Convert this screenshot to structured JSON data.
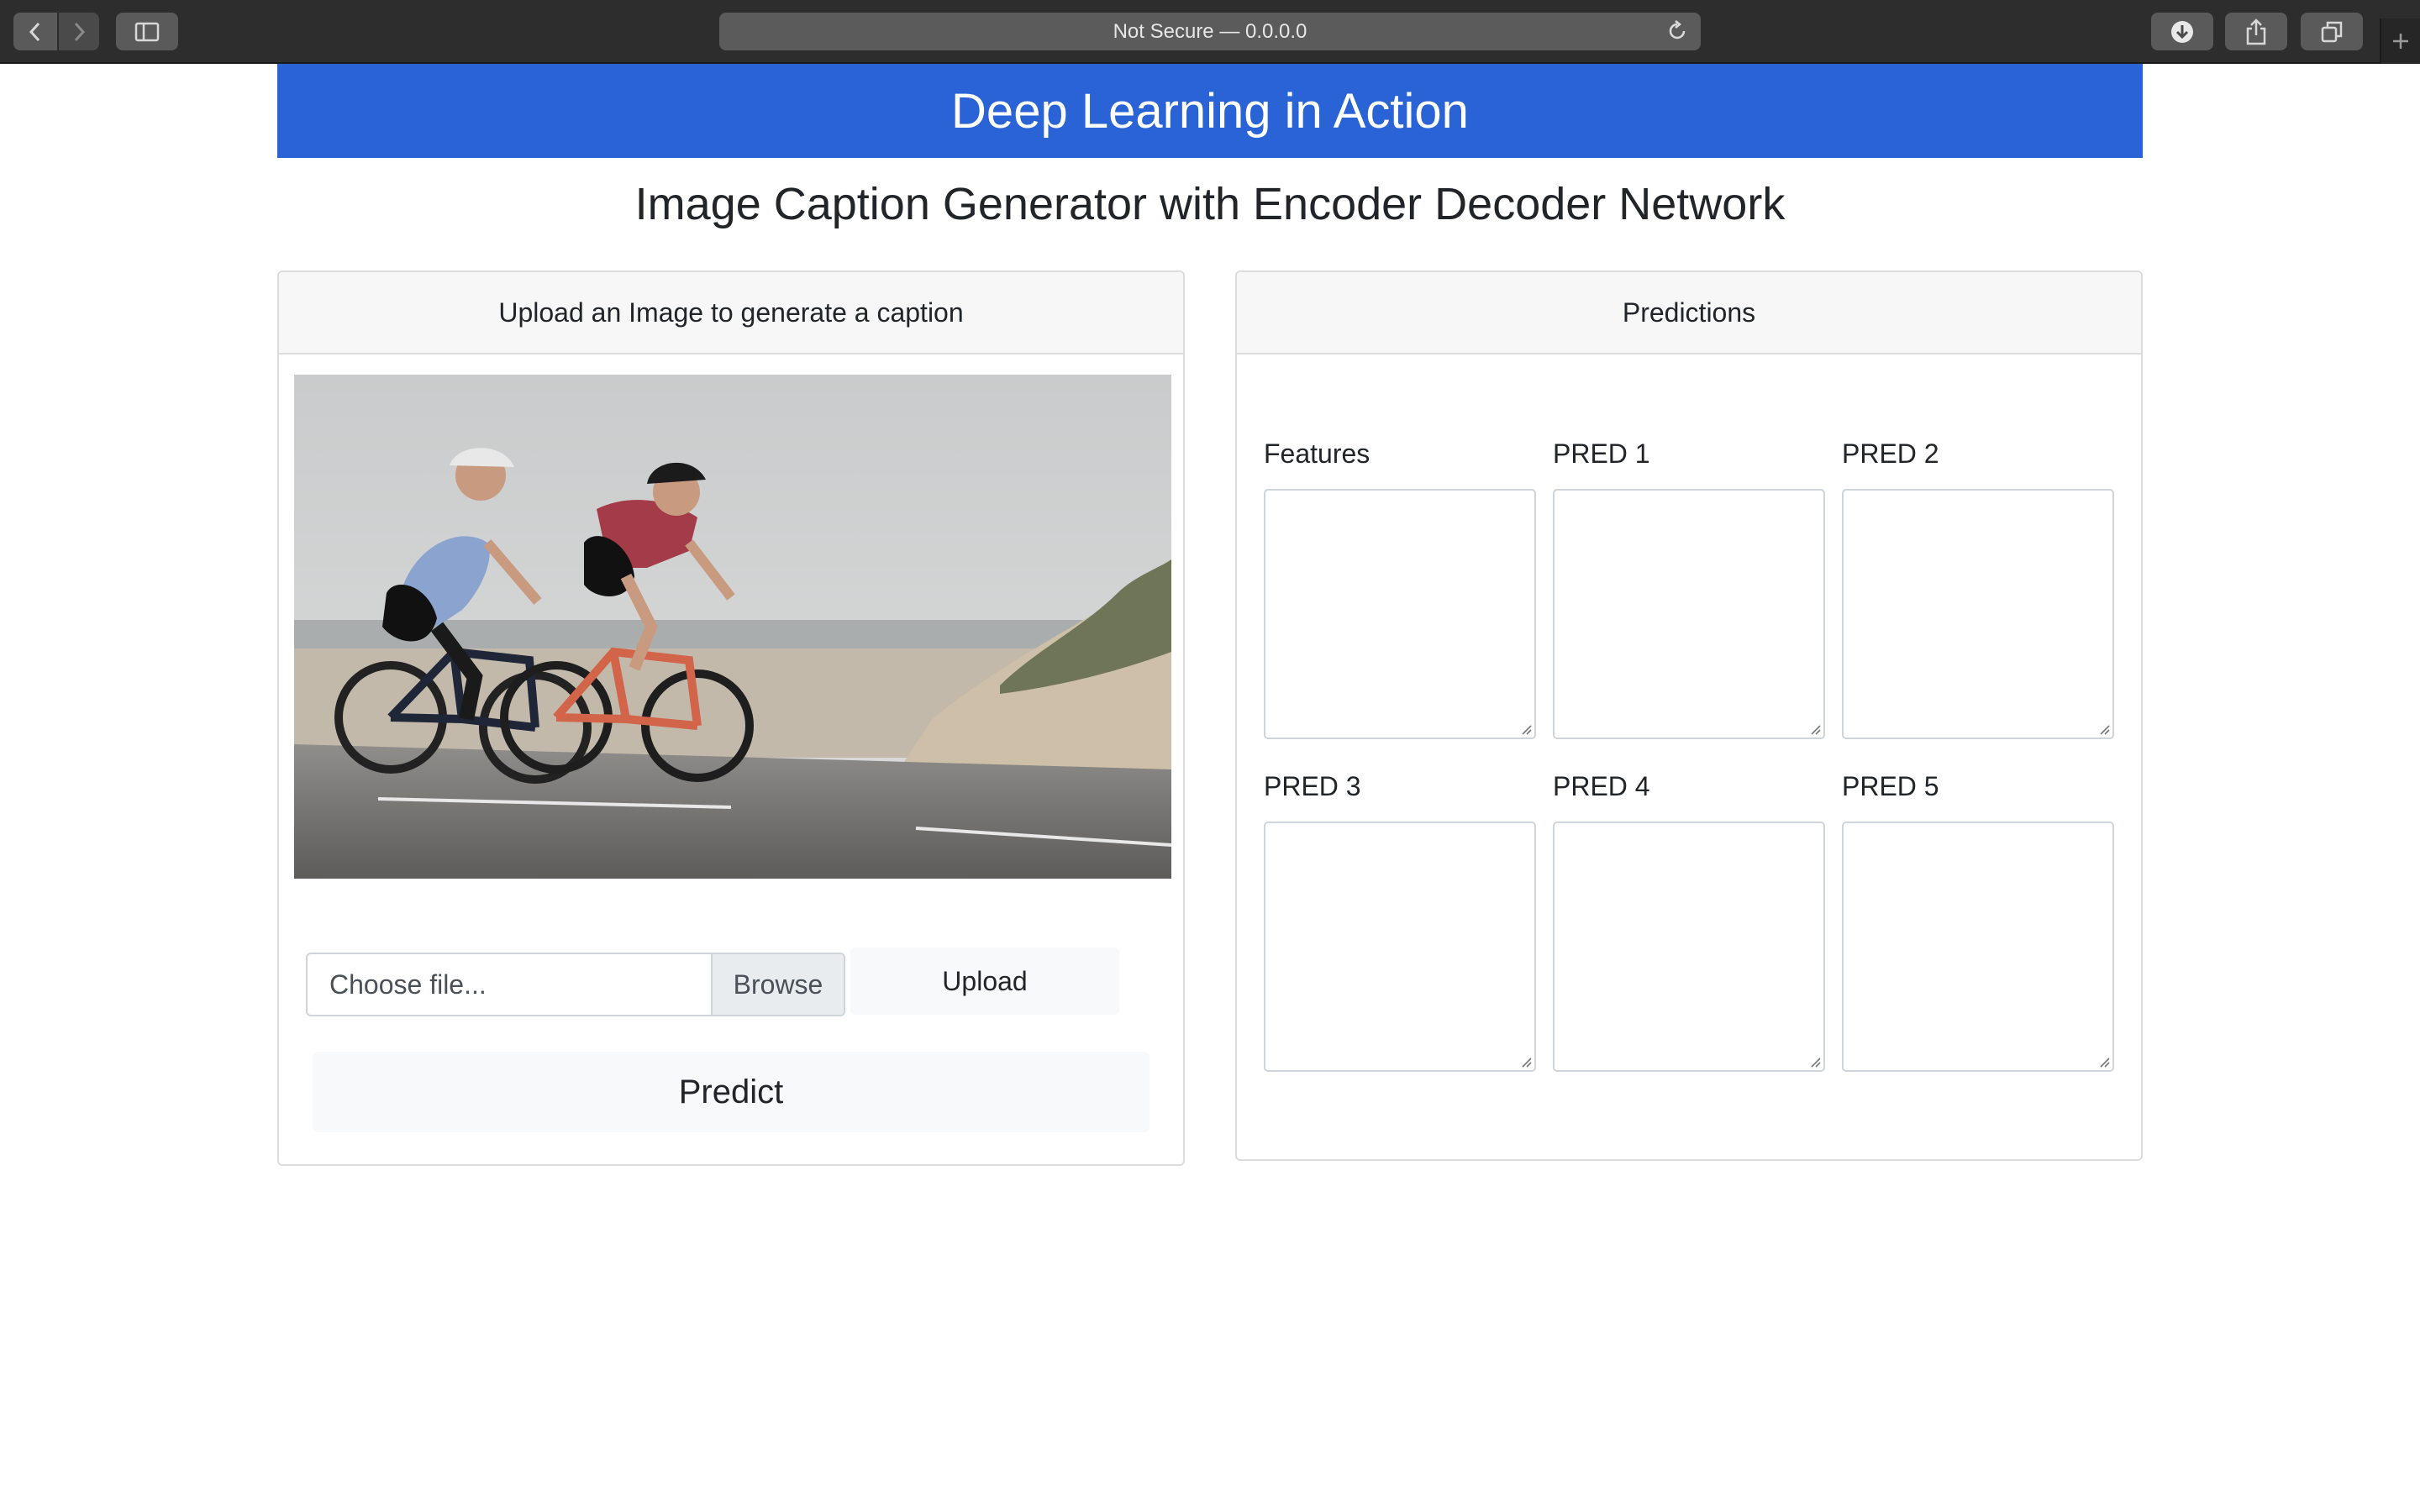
{
  "browser": {
    "address": "Not Secure — 0.0.0.0",
    "icons": [
      "back-icon",
      "forward-icon",
      "sidebar-icon",
      "reload-icon",
      "download-icon",
      "share-icon",
      "tabs-icon",
      "new-tab-icon"
    ]
  },
  "page": {
    "banner_title": "Deep Learning in Action",
    "subtitle": "Image Caption Generator with Encoder Decoder Network"
  },
  "upload_card": {
    "header": "Upload an Image to generate a caption",
    "file_placeholder": "Choose file...",
    "browse_label": "Browse",
    "upload_label": "Upload",
    "predict_label": "Predict"
  },
  "predictions_card": {
    "header": "Predictions",
    "fields": [
      {
        "label": "Features",
        "value": ""
      },
      {
        "label": "PRED 1",
        "value": ""
      },
      {
        "label": "PRED 2",
        "value": ""
      },
      {
        "label": "PRED 3",
        "value": ""
      },
      {
        "label": "PRED 4",
        "value": ""
      },
      {
        "label": "PRED 5",
        "value": ""
      }
    ]
  },
  "colors": {
    "banner": "#2a63d6",
    "chrome": "#2d2d2d",
    "card_header": "#f7f7f7",
    "button_light": "#f8f9fa"
  }
}
